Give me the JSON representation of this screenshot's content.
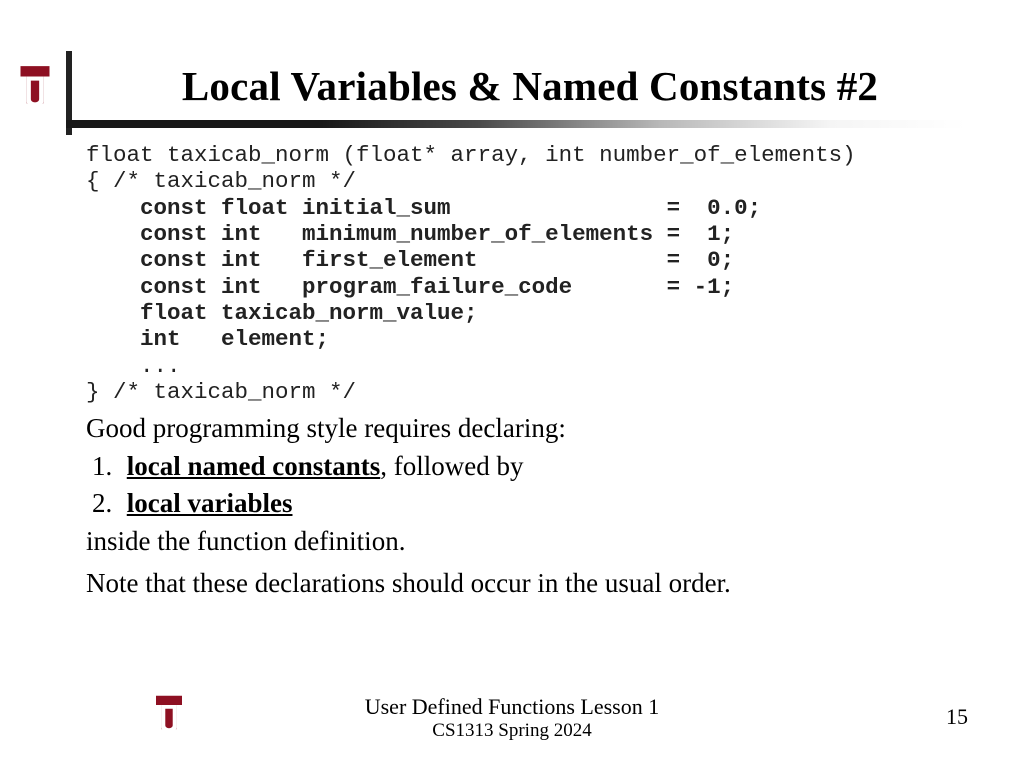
{
  "slide": {
    "title": "Local Variables & Named Constants #2",
    "code": {
      "l1": "float taxicab_norm (float* array, int number_of_elements)",
      "l2": "{ /* taxicab_norm */",
      "l3": "    const float initial_sum                =  0.0;",
      "l4": "    const int   minimum_number_of_elements =  1;",
      "l5": "    const int   first_element              =  0;",
      "l6": "    const int   program_failure_code       = -1;",
      "l7": "    float taxicab_norm_value;",
      "l8": "    int   element;",
      "l9": "    ...",
      "l10": "} /* taxicab_norm */"
    },
    "body": {
      "intro": "Good programming style requires declaring:",
      "item1_num": "1.",
      "item1_bold": "local named constants",
      "item1_rest": ", followed by",
      "item2_num": "2.",
      "item2_bold": "local variables",
      "line3": "inside the function definition.",
      "line4": "Note that these declarations should occur in the usual order."
    },
    "footer": {
      "line1": "User Defined Functions Lesson 1",
      "line2": "CS1313 Spring 2024",
      "page": "15"
    }
  }
}
